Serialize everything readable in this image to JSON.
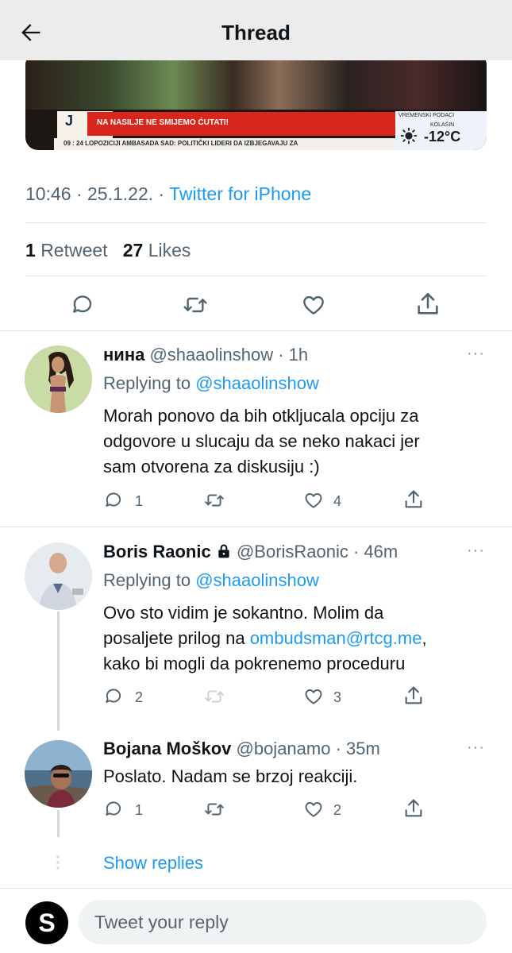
{
  "header": {
    "title": "Thread",
    "back_icon": "arrow-left-icon"
  },
  "media": {
    "channel_letter": "J",
    "headline": "NA NASILJE NE SMIJEMO ĆUTATI!",
    "ticker": "09 : 24  LOPOZICIJI   AMBASADA SAD: POLITIČKI LIDERI DA IZBJEGAVAJU ZA",
    "weather_header": "VREMENSKI PODACI",
    "weather_place": "KOLAŠIN",
    "weather_temp": "-12°C"
  },
  "tweet": {
    "time": "10:46 · 25.1.22. · ",
    "source": "Twitter for iPhone",
    "retweets_count": "1",
    "retweets_label": "Retweet",
    "likes_count": "27",
    "likes_label": "Likes"
  },
  "replies": [
    {
      "name": "нина",
      "handle_time": "@shaaolinshow · 1h",
      "replying_prefix": "Replying to ",
      "replying_handle": "@shaaolinshow",
      "text_lines": [
        "Morah ponovo da bih otkljucala opciju za",
        "odgovore u slucaju da se neko nakaci jer",
        "sam otvorena za diskusiju :)"
      ],
      "reply_count": "1",
      "like_count": "4"
    },
    {
      "name": "Boris Raonic",
      "handle_time": "@BorisRaonic · 46m",
      "replying_prefix": "Replying to ",
      "replying_handle": "@shaaolinshow",
      "line1": "Ovo sto vidim je sokantno. Molim da",
      "line2_pre": "posaljete prilog na ",
      "line2_link": "ombudsman@rtcg.me",
      "line2_post": ",",
      "line3": "kako bi mogli da pokrenemo proceduru",
      "reply_count": "2",
      "like_count": "3"
    },
    {
      "name": "Bojana Moškov",
      "handle_time": "@bojanamo · 35m",
      "text": "Poslato. Nadam se brzoj reakciji.",
      "reply_count": "1",
      "like_count": "2"
    }
  ],
  "show_replies": "Show replies",
  "compose": {
    "avatar_letter": "S",
    "placeholder": "Tweet your reply"
  },
  "colors": {
    "accent": "#1d9bf0",
    "muted": "#536471",
    "border": "#e1e6ea"
  }
}
